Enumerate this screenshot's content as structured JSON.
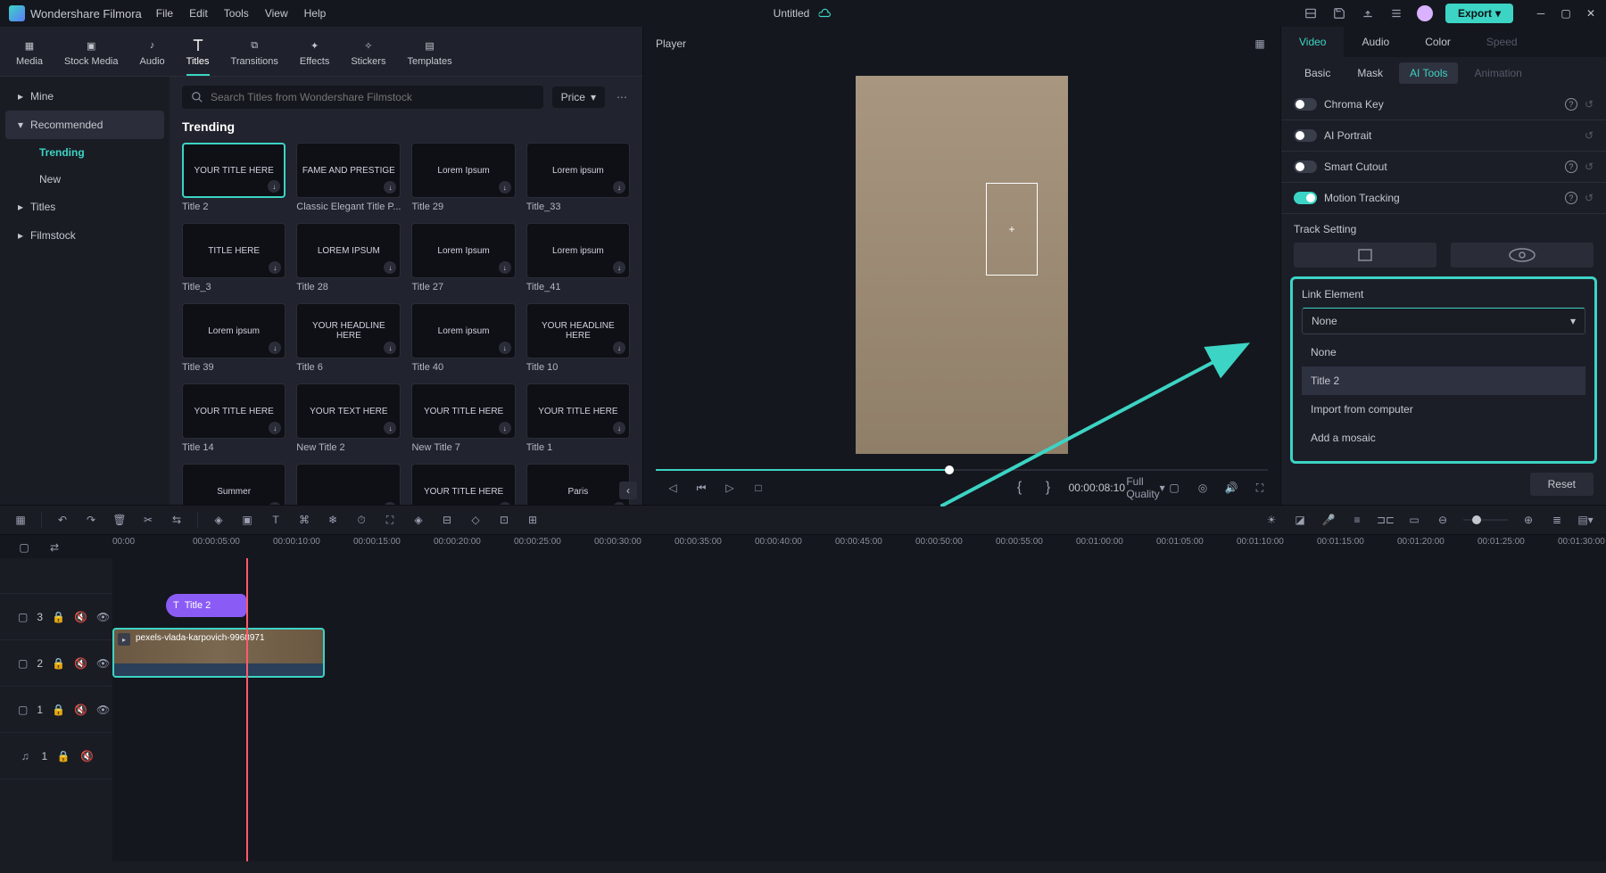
{
  "app": {
    "name": "Wondershare Filmora",
    "documentTitle": "Untitled",
    "export": "Export"
  },
  "menu": [
    "File",
    "Edit",
    "Tools",
    "View",
    "Help"
  ],
  "mediaTabs": [
    "Media",
    "Stock Media",
    "Audio",
    "Titles",
    "Transitions",
    "Effects",
    "Stickers",
    "Templates"
  ],
  "sidebar": {
    "items": [
      "Mine",
      "Recommended",
      "Titles",
      "Filmstock"
    ],
    "sub": [
      "Trending",
      "New"
    ]
  },
  "search": {
    "placeholder": "Search Titles from Wondershare Filmstock",
    "sort": "Price"
  },
  "sectionTitle": "Trending",
  "titles": [
    {
      "label": "Title 2",
      "text": "YOUR TITLE HERE"
    },
    {
      "label": "Classic Elegant Title P...",
      "text": "FAME AND PRESTIGE"
    },
    {
      "label": "Title 29",
      "text": "Lorem Ipsum"
    },
    {
      "label": "Title_33",
      "text": "Lorem ipsum"
    },
    {
      "label": "Title_3",
      "text": "TITLE HERE"
    },
    {
      "label": "Title 28",
      "text": "LOREM IPSUM"
    },
    {
      "label": "Title 27",
      "text": "Lorem Ipsum"
    },
    {
      "label": "Title_41",
      "text": "Lorem ipsum"
    },
    {
      "label": "Title 39",
      "text": "Lorem ipsum"
    },
    {
      "label": "Title 6",
      "text": "YOUR HEADLINE HERE"
    },
    {
      "label": "Title 40",
      "text": "Lorem ipsum"
    },
    {
      "label": "Title 10",
      "text": "YOUR HEADLINE HERE"
    },
    {
      "label": "Title 14",
      "text": "YOUR TITLE HERE"
    },
    {
      "label": "New Title 2",
      "text": "YOUR TEXT HERE"
    },
    {
      "label": "New Title 7",
      "text": "YOUR TITLE HERE"
    },
    {
      "label": "Title 1",
      "text": "YOUR TITLE HERE"
    },
    {
      "label": "",
      "text": "Summer"
    },
    {
      "label": "",
      "text": ""
    },
    {
      "label": "",
      "text": "YOUR TITLE HERE"
    },
    {
      "label": "",
      "text": "Paris"
    }
  ],
  "player": {
    "title": "Player",
    "quality": "Full Quality",
    "timecode": "00:00:08:10"
  },
  "rightPanel": {
    "tabsTop": [
      "Video",
      "Audio",
      "Color",
      "Speed"
    ],
    "tabsSub": [
      "Basic",
      "Mask",
      "AI Tools",
      "Animation"
    ],
    "sections": {
      "chroma": "Chroma Key",
      "portrait": "AI Portrait",
      "cutout": "Smart Cutout",
      "tracking": "Motion Tracking"
    },
    "trackSetting": "Track Setting",
    "linkElement": {
      "label": "Link Element",
      "selected": "None",
      "options": [
        "None",
        "Title 2",
        "Import from computer",
        "Add a mosaic"
      ]
    },
    "reset": "Reset"
  },
  "ruler": [
    "00:00",
    "00:00:05:00",
    "00:00:10:00",
    "00:00:15:00",
    "00:00:20:00",
    "00:00:25:00",
    "00:00:30:00",
    "00:00:35:00",
    "00:00:40:00",
    "00:00:45:00",
    "00:00:50:00",
    "00:00:55:00",
    "00:01:00:00",
    "00:01:05:00",
    "00:01:10:00",
    "00:01:15:00",
    "00:01:20:00",
    "00:01:25:00",
    "00:01:30:00"
  ],
  "tracks": {
    "t3": "3",
    "t2": "2",
    "t1": "1",
    "a1": "1",
    "titleClip": "Title 2",
    "videoClip": "pexels-vlada-karpovich-9968971"
  }
}
